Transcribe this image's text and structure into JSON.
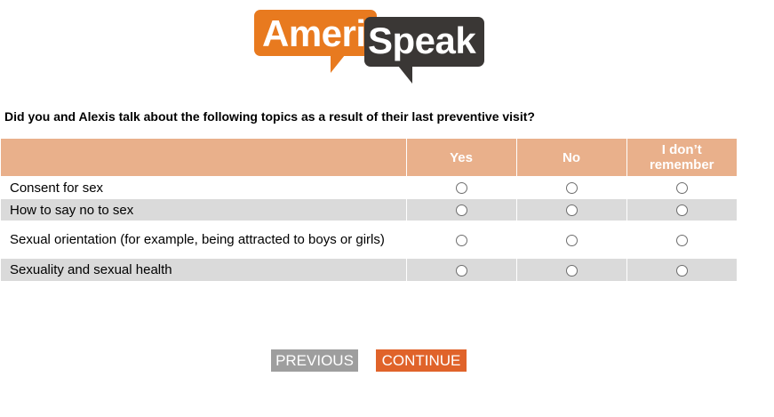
{
  "logo": {
    "part1": "Ameri",
    "part2": "Speak",
    "colors": {
      "orange": "#e87a1f",
      "dark": "#3a3735"
    }
  },
  "question": "Did you and Alexis talk about the following topics as a result of their last preventive visit?",
  "columns": [
    "Yes",
    "No",
    "I don’t remember"
  ],
  "rows": [
    {
      "label": "Consent for sex"
    },
    {
      "label": "How to say no to sex"
    },
    {
      "label": "Sexual orientation (for example, being attracted to boys or girls)"
    },
    {
      "label": "Sexuality and sexual health"
    }
  ],
  "buttons": {
    "previous": "PREVIOUS",
    "continue": "CONTINUE"
  },
  "colors": {
    "header_bg": "#e9b08b",
    "stripe": "#dadada",
    "previous_bg": "#9e9e9e",
    "continue_bg": "#e0632a"
  }
}
